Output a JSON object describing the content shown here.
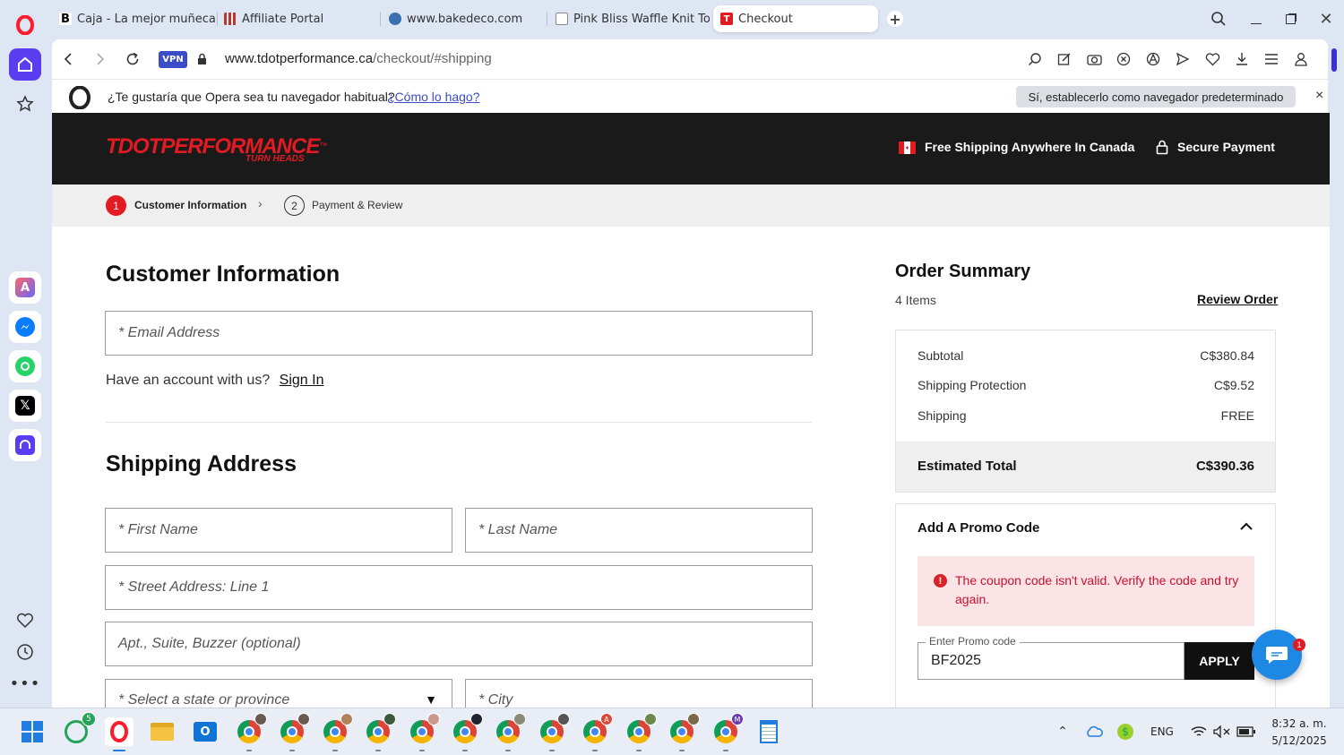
{
  "browser": {
    "tabs": [
      {
        "label": "Caja - La mejor muñeca se",
        "favicon": "B"
      },
      {
        "label": "Affiliate Portal",
        "favicon": "grid"
      },
      {
        "label": "www.bakedeco.com",
        "favicon": "headset"
      },
      {
        "label": "Pink Bliss Waffle Knit Top",
        "favicon": "doc"
      },
      {
        "label": "Checkout",
        "favicon": "T"
      }
    ],
    "vpn_label": "VPN",
    "url_domain": "www.tdotperformance.ca",
    "url_path": "/checkout/#shipping"
  },
  "infobar": {
    "question": "¿Te gustaría que Opera sea tu navegador habitual?",
    "how_link": "¿Cómo lo hago?",
    "set_default_button": "Sí, establecerlo como navegador predeterminado",
    "close": "×"
  },
  "site": {
    "logo_main": "TDOTPERFORMANCE",
    "logo_tm": "™",
    "logo_tagline": "TURN HEADS",
    "free_shipping": "Free Shipping Anywhere In Canada",
    "secure_payment": "Secure Payment"
  },
  "steps": [
    {
      "number": "1",
      "label": "Customer Information"
    },
    {
      "number": "2",
      "label": "Payment & Review"
    }
  ],
  "customer_info": {
    "heading": "Customer Information",
    "email_placeholder": "* Email Address",
    "account_prompt": "Have an account with us?",
    "sign_in": "Sign In"
  },
  "shipping": {
    "heading": "Shipping Address",
    "first_name": "* First Name",
    "last_name": "* Last Name",
    "street": "* Street Address: Line 1",
    "apt": "Apt., Suite, Buzzer (optional)",
    "state": "* Select a state or province",
    "city": "* City"
  },
  "summary": {
    "heading": "Order Summary",
    "items": "4 Items",
    "review_link": "Review Order",
    "subtotal_label": "Subtotal",
    "subtotal_value": "C$380.84",
    "protection_label": "Shipping Protection",
    "protection_value": "C$9.52",
    "shipping_label": "Shipping",
    "shipping_value": "FREE",
    "total_label": "Estimated Total",
    "total_value": "C$390.36"
  },
  "promo": {
    "heading": "Add A Promo Code",
    "error": "The coupon code isn't valid. Verify the code and try again.",
    "field_label": "Enter Promo code",
    "field_value": "BF2025",
    "apply": "APPLY"
  },
  "chat": {
    "badge": "1"
  },
  "taskbar": {
    "whatsapp_badge": "5",
    "lang": "ENG",
    "time": "8:32 a. m.",
    "date": "5/12/2025"
  },
  "colors": {
    "brand_red": "#e21b23",
    "header_bg": "#1a1a1a",
    "chat_blue": "#1e88e5",
    "opera_red": "#ff1b2d"
  }
}
